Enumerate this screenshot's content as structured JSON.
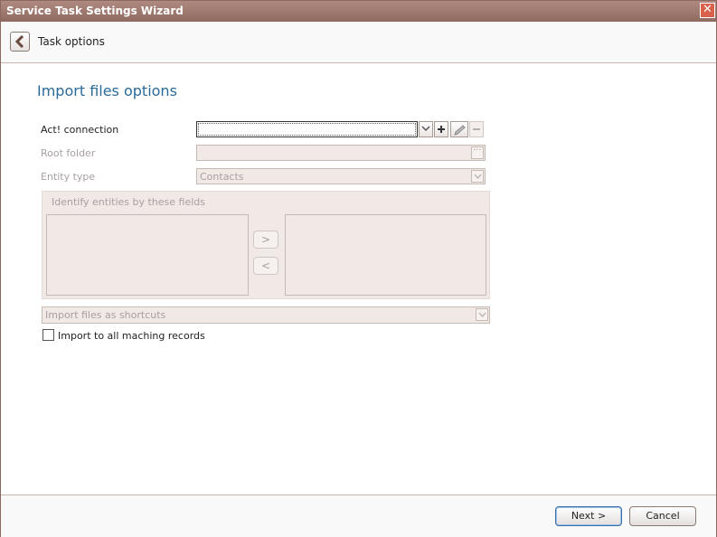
{
  "window": {
    "title": "Service Task Settings Wizard",
    "close_glyph": "✕"
  },
  "header": {
    "title": "Task options"
  },
  "section": {
    "title": "Import files options"
  },
  "form": {
    "connection_label": "Act! connection",
    "connection_value": "",
    "root_folder_label": "Root folder",
    "root_folder_value": "",
    "browse_glyph": "···",
    "entity_type_label": "Entity type",
    "entity_type_value": "Contacts",
    "identify_group_title": "Identify entities by these fields",
    "move_right_label": ">",
    "move_left_label": "<",
    "import_mode_value": "Import files as shortcuts",
    "import_all_label": "Import to all maching records",
    "import_all_checked": false
  },
  "footer": {
    "next_label": "Next >",
    "cancel_label": "Cancel"
  },
  "colors": {
    "title_bar": "#9c786e",
    "section_title": "#2a6a9a",
    "disabled_fill": "#f1e9e6",
    "disabled_text": "#a8a0a0"
  }
}
